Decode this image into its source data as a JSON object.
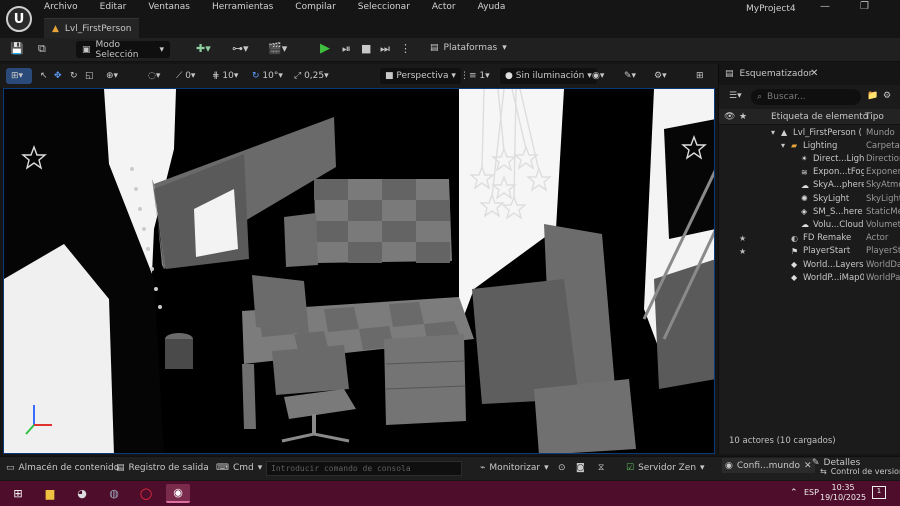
{
  "app": {
    "logo": "U",
    "menu": [
      "Archivo",
      "Editar",
      "Ventanas",
      "Herramientas",
      "Compilar",
      "Seleccionar",
      "Actor",
      "Ayuda"
    ],
    "project_name": "MyProject4",
    "window_controls": [
      "—",
      "❐",
      "✕"
    ],
    "level_tab": "Lvl_FirstPerson"
  },
  "toolbar": {
    "mode_label": "Modo Selección",
    "platforms_label": "Plataformas"
  },
  "viewport_toolbar": {
    "view_mode": "Perspectiva",
    "lighting_mode": "Sin iluminación",
    "grid_snap": "10",
    "rotation_snap": "10°",
    "scale_snap": "0,25",
    "angle_value": "0",
    "camera_speed": "1"
  },
  "outliner": {
    "title": "Esquematizador",
    "search_placeholder": "Buscar...",
    "col_label": "Etiqueta de elemento",
    "col_type": "Tipo",
    "rows": [
      {
        "label": "Lvl_FirstPerson (",
        "type": "Mundo",
        "indent": 0,
        "icon": "world-icon",
        "star": false
      },
      {
        "label": "Lighting",
        "type": "Carpeta",
        "indent": 1,
        "icon": "folder-icon",
        "star": false
      },
      {
        "label": "Direct...Light",
        "type": "Direction",
        "indent": 2,
        "icon": "directional-light-icon",
        "star": false
      },
      {
        "label": "Expon...tFog",
        "type": "Exponen",
        "indent": 2,
        "icon": "fog-icon",
        "star": false
      },
      {
        "label": "SkyA...phere",
        "type": "SkyAtmo",
        "indent": 2,
        "icon": "sky-atmosphere-icon",
        "star": false
      },
      {
        "label": "SkyLight",
        "type": "SkyLight",
        "indent": 2,
        "icon": "sky-light-icon",
        "star": false
      },
      {
        "label": "SM_S...here",
        "type": "StaticMe",
        "indent": 2,
        "icon": "static-mesh-icon",
        "star": false
      },
      {
        "label": "Volu...Cloud",
        "type": "Volumetr",
        "indent": 2,
        "icon": "cloud-icon",
        "star": false
      },
      {
        "label": "FD Remake",
        "type": "Actor",
        "indent": 1,
        "icon": "actor-icon",
        "star": true
      },
      {
        "label": "PlayerStart",
        "type": "PlayerSt",
        "indent": 1,
        "icon": "player-start-icon",
        "star": true
      },
      {
        "label": "World...Layers",
        "type": "WorldDa",
        "indent": 1,
        "icon": "layers-icon",
        "star": false
      },
      {
        "label": "WorldP...iMap0",
        "type": "WorldPa",
        "indent": 1,
        "icon": "world-partition-icon",
        "star": false
      }
    ],
    "actor_count": "10 actores (10 cargados)"
  },
  "bottombar": {
    "content_drawer": "Almacén de contenido",
    "output_log": "Registro de salida",
    "cmd": "Cmd",
    "console_placeholder": "Introducir comando de consola",
    "monitor": "Monitorizar",
    "zen_server": "Servidor Zen",
    "tab_world_settings": "Confi...mundo",
    "tab_details": "Detalles",
    "version_control": "Control de versiones"
  },
  "taskbar": {
    "language": "ESP",
    "time": "10:35",
    "date": "19/10/2025",
    "notifications": "1"
  },
  "colors": {
    "accent_blue": "#0a5fd1",
    "play_green": "#3fbf3f",
    "taskbar": "#4e0d2a",
    "folder": "#e8a33b"
  }
}
